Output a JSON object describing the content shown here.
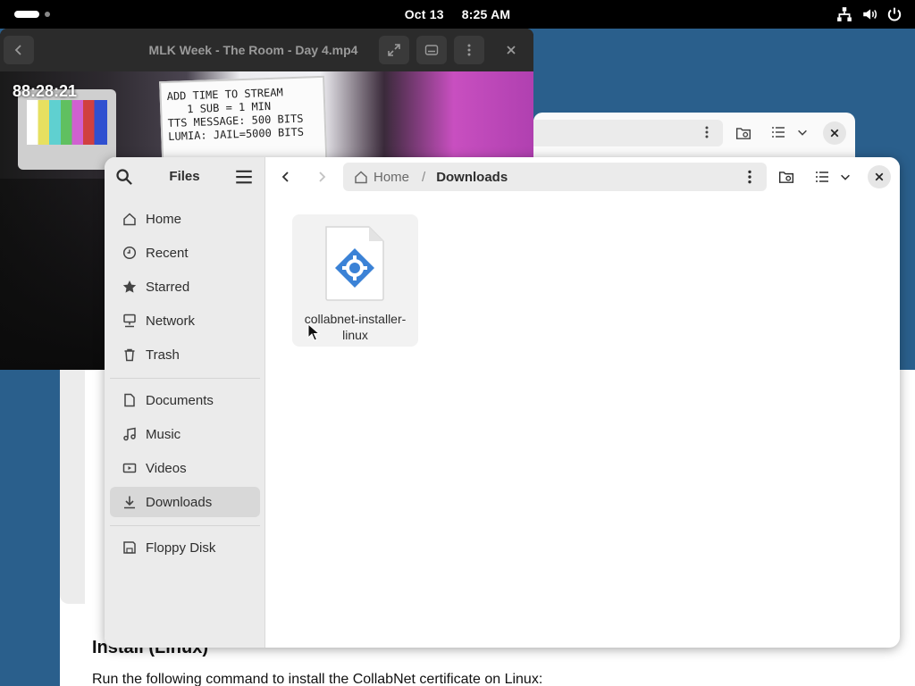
{
  "topbar": {
    "date": "Oct 13",
    "time": "8:25 AM",
    "status_icons": [
      "network-icon",
      "volume-icon",
      "power-icon"
    ]
  },
  "video_player": {
    "title": "MLK Week - The Room - Day 4.mp4",
    "overlay_timer": "88:28:21",
    "board_lines": [
      "ADD TIME TO STREAM",
      "1 SUB = 1 MIN",
      "TTS MESSAGE: 500 BITS",
      "LUMIA: JAIL=5000 BITS"
    ]
  },
  "files": {
    "sidebar_title": "Files",
    "places": [
      {
        "label": "Home",
        "icon": "home-icon"
      },
      {
        "label": "Recent",
        "icon": "clock-icon"
      },
      {
        "label": "Starred",
        "icon": "star-icon"
      },
      {
        "label": "Network",
        "icon": "network-icon"
      },
      {
        "label": "Trash",
        "icon": "trash-icon"
      }
    ],
    "bookmarks": [
      {
        "label": "Documents",
        "icon": "document-icon"
      },
      {
        "label": "Music",
        "icon": "music-icon"
      },
      {
        "label": "Videos",
        "icon": "video-icon"
      },
      {
        "label": "Downloads",
        "icon": "download-icon",
        "active": true
      }
    ],
    "devices": [
      {
        "label": "Floppy Disk",
        "icon": "floppy-icon"
      }
    ],
    "path": {
      "home_label": "Home",
      "separator": "/",
      "current": "Downloads"
    },
    "items": [
      {
        "name_line1": "collabnet-installer-",
        "name_line2": "linux",
        "icon": "executable-file-icon"
      }
    ]
  },
  "background_doc": {
    "heading": "Install (Linux)",
    "text": "Run the following command to install the CollabNet certificate on Linux:"
  },
  "colors": {
    "desktop": "#2a5f8c",
    "sidebar_bg": "#ebebeb",
    "active_item": "#d8d8d8",
    "file_icon_blue": "#3b82d6"
  }
}
